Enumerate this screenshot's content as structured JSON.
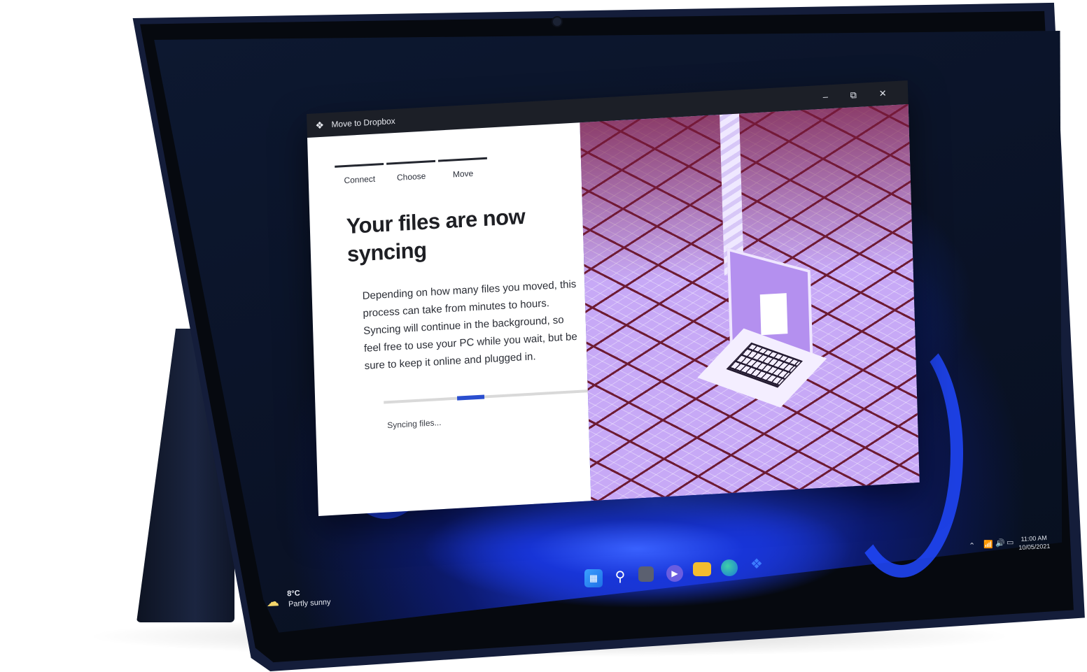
{
  "window": {
    "title": "Move to Dropbox",
    "controls": {
      "minimize": "–",
      "maximize": "⧉",
      "close": "✕"
    }
  },
  "steps": [
    {
      "label": "Connect"
    },
    {
      "label": "Choose"
    },
    {
      "label": "Move"
    }
  ],
  "content": {
    "headline": "Your files are now syncing",
    "body": "Depending on how many files you moved, this process can take from minutes to hours. Syncing will continue in the background, so feel free to use your PC while you wait, but be sure to keep it online and plugged in.",
    "progress_fraction": 0.12,
    "status": "Syncing files..."
  },
  "taskbar": {
    "weather": {
      "temp": "8°C",
      "desc": "Partly sunny",
      "icon": "partly-cloudy-icon"
    },
    "apps": [
      {
        "name": "start",
        "icon": "windows-logo-icon"
      },
      {
        "name": "search",
        "icon": "search-icon"
      },
      {
        "name": "task-view",
        "icon": "task-view-icon"
      },
      {
        "name": "teams",
        "icon": "chat-icon"
      },
      {
        "name": "file-explorer",
        "icon": "folder-icon"
      },
      {
        "name": "edge",
        "icon": "edge-icon"
      },
      {
        "name": "dropbox",
        "icon": "dropbox-icon"
      }
    ],
    "clock": {
      "time": "11:00 AM",
      "date": "10/05/2021"
    }
  },
  "colors": {
    "accent": "#2a4ecf",
    "illustration": "#c7a9f6",
    "grid": "#6d1b33"
  }
}
